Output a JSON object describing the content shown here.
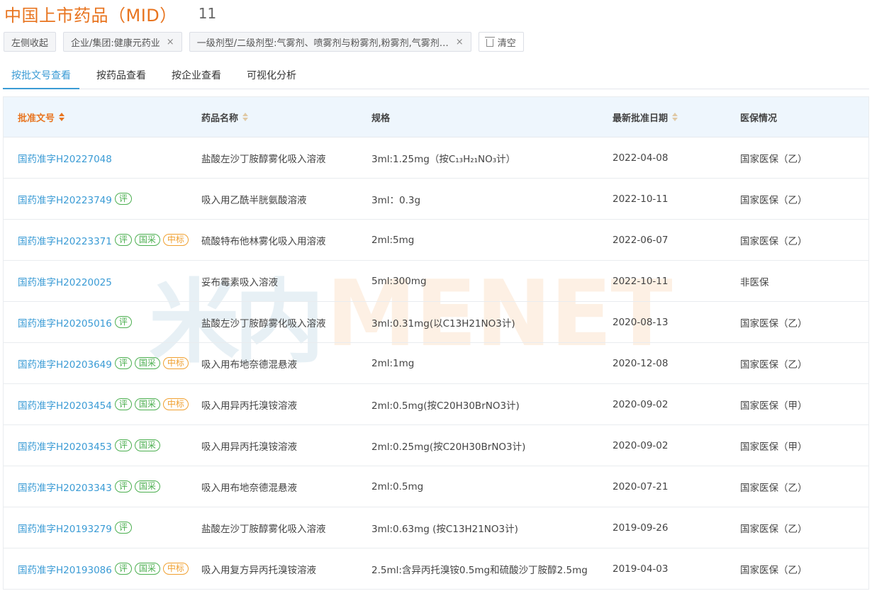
{
  "header": {
    "title": "中国上市药品（MID）",
    "count": "11"
  },
  "filters": {
    "collapse_label": "左侧收起",
    "chip1": "企业/集团:健康元药业",
    "chip2": "一级剂型/二级剂型:气雾剂、喷雾剂与粉雾剂,粉雾剂,气雾剂,吸入溶液",
    "close_glyph": "×",
    "clear_label": "清空"
  },
  "tabs": [
    "按批文号查看",
    "按药品查看",
    "按企业查看",
    "可视化分析"
  ],
  "columns": [
    "批准文号",
    "药品名称",
    "规格",
    "最新批准日期",
    "医保情况"
  ],
  "badges": {
    "ping": "评",
    "guocai": "国采",
    "zhongbiao": "中标"
  },
  "rows": [
    {
      "approval": "国药准字H20227048",
      "name": "盐酸左沙丁胺醇雾化吸入溶液",
      "spec": "3ml:1.25mg（按C₁₃H₂₁NO₃计）",
      "date": "2022-04-08",
      "insurance": "国家医保（乙）",
      "tags": []
    },
    {
      "approval": "国药准字H20223749",
      "name": "吸入用乙酰半胱氨酸溶液",
      "spec": "3ml：0.3g",
      "date": "2022-10-11",
      "insurance": "国家医保（乙）",
      "tags": [
        "ping"
      ]
    },
    {
      "approval": "国药准字H20223371",
      "name": "硫酸特布他林雾化吸入用溶液",
      "spec": "2ml:5mg",
      "date": "2022-06-07",
      "insurance": "国家医保（乙）",
      "tags": [
        "ping",
        "guocai",
        "zhongbiao"
      ]
    },
    {
      "approval": "国药准字H20220025",
      "name": "妥布霉素吸入溶液",
      "spec": "5ml:300mg",
      "date": "2022-10-11",
      "insurance": "非医保",
      "tags": []
    },
    {
      "approval": "国药准字H20205016",
      "name": "盐酸左沙丁胺醇雾化吸入溶液",
      "spec": "3ml:0.31mg(以C13H21NO3计)",
      "date": "2020-08-13",
      "insurance": "国家医保（乙）",
      "tags": [
        "ping"
      ]
    },
    {
      "approval": "国药准字H20203649",
      "name": "吸入用布地奈德混悬液",
      "spec": "2ml:1mg",
      "date": "2020-12-08",
      "insurance": "国家医保（乙）",
      "tags": [
        "ping",
        "guocai",
        "zhongbiao"
      ]
    },
    {
      "approval": "国药准字H20203454",
      "name": "吸入用异丙托溴铵溶液",
      "spec": "2ml:0.5mg(按C20H30BrNO3计)",
      "date": "2020-09-02",
      "insurance": "国家医保（甲）",
      "tags": [
        "ping",
        "guocai",
        "zhongbiao"
      ]
    },
    {
      "approval": "国药准字H20203453",
      "name": "吸入用异丙托溴铵溶液",
      "spec": "2ml:0.25mg(按C20H30BrNO3计)",
      "date": "2020-09-02",
      "insurance": "国家医保（甲）",
      "tags": [
        "ping",
        "guocai"
      ]
    },
    {
      "approval": "国药准字H20203343",
      "name": "吸入用布地奈德混悬液",
      "spec": "2ml:0.5mg",
      "date": "2020-07-21",
      "insurance": "国家医保（乙）",
      "tags": [
        "ping",
        "guocai"
      ]
    },
    {
      "approval": "国药准字H20193279",
      "name": "盐酸左沙丁胺醇雾化吸入溶液",
      "spec": "3ml:0.63mg (按C13H21NO3计)",
      "date": "2019-09-26",
      "insurance": "国家医保（乙）",
      "tags": [
        "ping"
      ]
    },
    {
      "approval": "国药准字H20193086",
      "name": "吸入用复方异丙托溴铵溶液",
      "spec": "2.5ml:含异丙托溴铵0.5mg和硫酸沙丁胺醇2.5mg",
      "date": "2019-04-03",
      "insurance": "国家医保（乙）",
      "tags": [
        "ping",
        "guocai",
        "zhongbiao"
      ]
    }
  ],
  "watermark": {
    "cn": "米内",
    "en": "MENET"
  },
  "colors": {
    "accent_orange": "#e8741f",
    "link_blue": "#3a9bd5",
    "badge_green": "#4caf50",
    "badge_orange": "#f0a030"
  }
}
